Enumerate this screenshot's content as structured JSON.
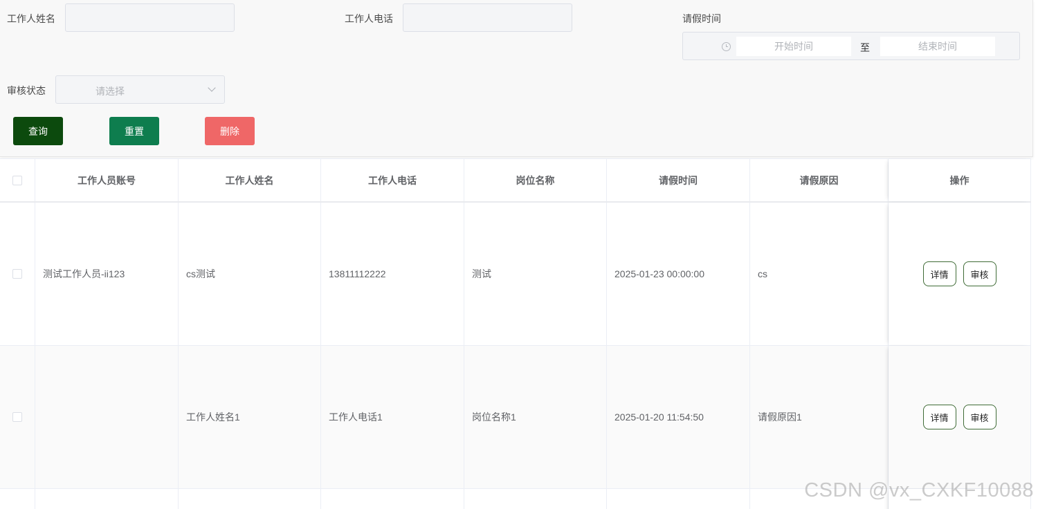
{
  "search": {
    "worker_name_label": "工作人姓名",
    "worker_name_value": "",
    "worker_phone_label": "工作人电话",
    "worker_phone_value": "",
    "leave_time_label": "请假时间",
    "start_placeholder": "开始时间",
    "range_separator": "至",
    "end_placeholder": "结束时间",
    "audit_status_label": "审核状态",
    "audit_status_placeholder": "请选择",
    "query_button": "查询",
    "reset_button": "重置",
    "delete_button": "删除"
  },
  "colors": {
    "query_button": "#0c4a0d",
    "reset_button": "#0e7d4e",
    "delete_button": "#ef6767"
  },
  "table": {
    "headers": [
      "工作人员账号",
      "工作人姓名",
      "工作人电话",
      "岗位名称",
      "请假时间",
      "请假原因",
      "操作"
    ],
    "rows": [
      {
        "account": "测试工作人员-ii123",
        "name": "cs测试",
        "phone": "13811112222",
        "position": "测试",
        "leave_time": "2025-01-23 00:00:00",
        "reason": "cs",
        "detail_label": "详情",
        "audit_label": "审核"
      },
      {
        "account": "",
        "name": "工作人姓名1",
        "phone": "工作人电话1",
        "position": "岗位名称1",
        "leave_time": "2025-01-20 11:54:50",
        "reason": "请假原因1",
        "detail_label": "详情",
        "audit_label": "审核"
      }
    ]
  },
  "watermark": "CSDN @vx_CXKF10088"
}
